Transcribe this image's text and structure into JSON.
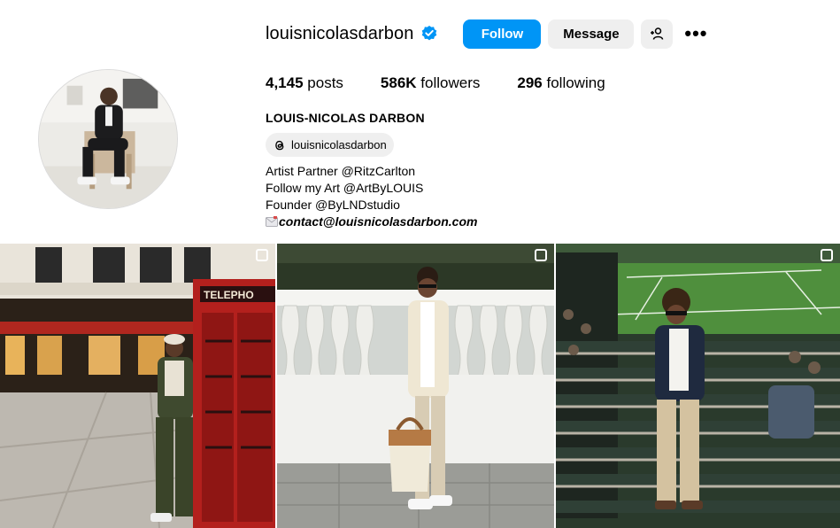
{
  "profile": {
    "username": "louisnicolasdarbon",
    "verified_icon": "verified-badge-icon",
    "full_name": "LOUIS-NICOLAS DARBON",
    "threads_handle": "louisnicolasdarbon"
  },
  "actions": {
    "follow_label": "Follow",
    "message_label": "Message",
    "add_user_icon": "person-add-icon",
    "more_label": "•••"
  },
  "stats": {
    "posts_count": "4,145",
    "posts_label": "posts",
    "followers_count": "586K",
    "followers_label": "followers",
    "following_count": "296",
    "following_label": "following"
  },
  "bio": {
    "line1": "Artist Partner @RitzCarlton",
    "line2": "Follow my Art @ArtByLOUIS",
    "line3": "Founder @ByLNDstudio",
    "email": "contact@louisnicolasdarbon.com"
  },
  "sign_text": "TELEPHO",
  "colors": {
    "accent": "#0095f6",
    "button_gray": "#efefef",
    "verified": "#0095f6"
  }
}
